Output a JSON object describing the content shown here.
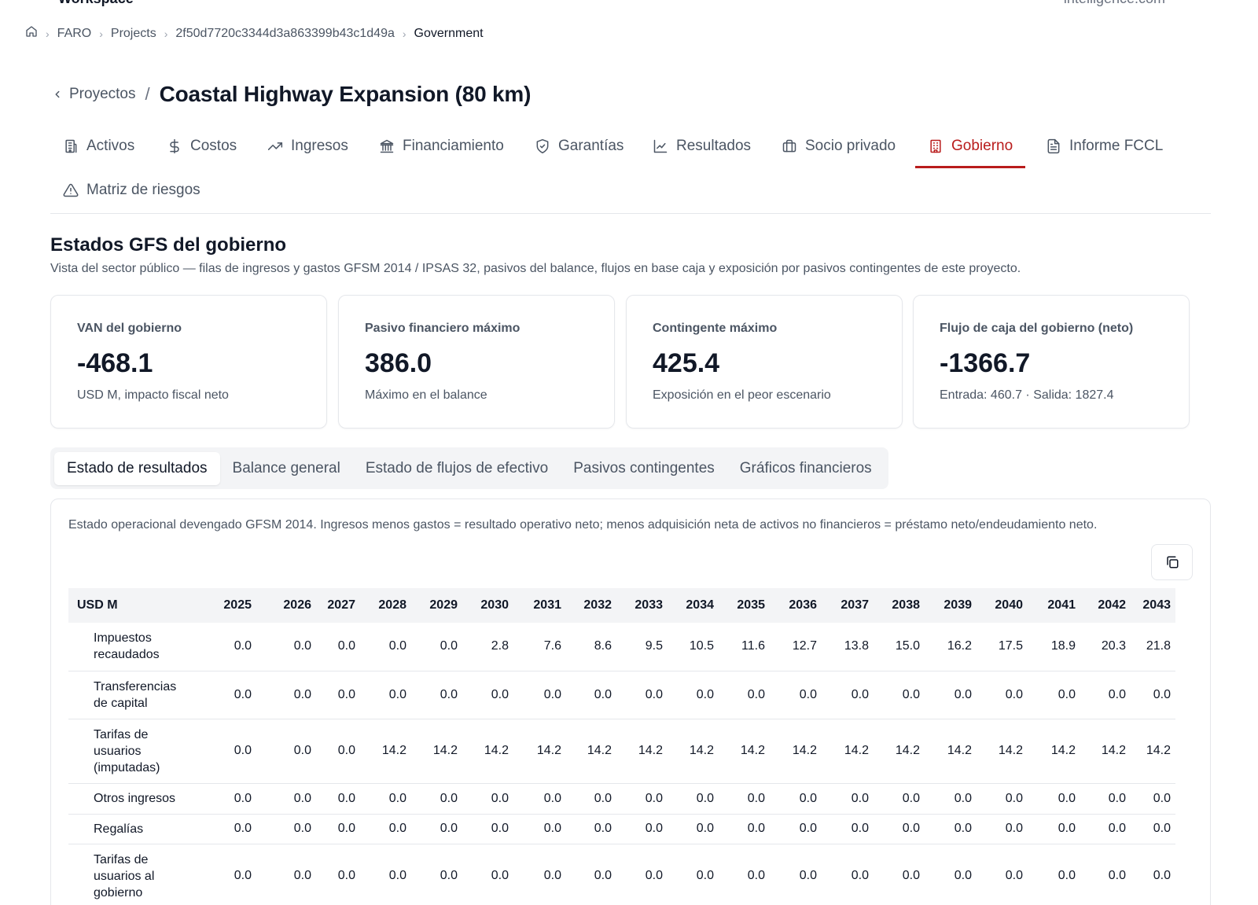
{
  "top": {
    "left_text": "Workspace",
    "right_text": "intelligence.com"
  },
  "breadcrumb": {
    "items": [
      "FARO",
      "Projects",
      "2f50d7720c3344d3a863399b43c1d49a"
    ],
    "current": "Government"
  },
  "header": {
    "back_label": "Proyectos",
    "separator": "/",
    "title": "Coastal Highway Expansion (80 km)"
  },
  "tabs": [
    {
      "label": "Activos",
      "icon": "building-icon"
    },
    {
      "label": "Costos",
      "icon": "dollar-icon"
    },
    {
      "label": "Ingresos",
      "icon": "trending-up-icon"
    },
    {
      "label": "Financiamiento",
      "icon": "bank-icon"
    },
    {
      "label": "Garantías",
      "icon": "shield-icon"
    },
    {
      "label": "Resultados",
      "icon": "line-chart-icon"
    },
    {
      "label": "Socio privado",
      "icon": "briefcase-icon"
    },
    {
      "label": "Gobierno",
      "icon": "government-building-icon",
      "active": true
    },
    {
      "label": "Informe FCCL",
      "icon": "file-icon"
    },
    {
      "label": "Matriz de riesgos",
      "icon": "warning-icon"
    }
  ],
  "section": {
    "title": "Estados GFS del gobierno",
    "description": "Vista del sector público — filas de ingresos y gastos GFSM 2014 / IPSAS 32, pasivos del balance, flujos en base caja y exposición por pasivos contingentes de este proyecto."
  },
  "kpis": [
    {
      "label": "VAN del gobierno",
      "value": "-468.1",
      "sub": "USD M, impacto fiscal neto"
    },
    {
      "label": "Pasivo financiero máximo",
      "value": "386.0",
      "sub": "Máximo en el balance"
    },
    {
      "label": "Contingente máximo",
      "value": "425.4",
      "sub": "Exposición en el peor escenario"
    },
    {
      "label": "Flujo de caja del gobierno (neto)",
      "value": "-1366.7",
      "sub": "Entrada: 460.7 · Salida: 1827.4"
    }
  ],
  "subtabs": [
    "Estado de resultados",
    "Balance general",
    "Estado de flujos de efectivo",
    "Pasivos contingentes",
    "Gráficos financieros"
  ],
  "panel": {
    "description": "Estado operacional devengado GFSM 2014. Ingresos menos gastos = resultado operativo neto; menos adquisición neta de activos no financieros = préstamo neto/endeudamiento neto.",
    "copy_icon": "copy-icon"
  },
  "table": {
    "unit_header": "USD M",
    "years": [
      "2025",
      "2026",
      "2027",
      "2028",
      "2029",
      "2030",
      "2031",
      "2032",
      "2033",
      "2034",
      "2035",
      "2036",
      "2037",
      "2038",
      "2039",
      "2040",
      "2041",
      "2042",
      "2043"
    ],
    "rows": [
      {
        "label": "Impuestos recaudados",
        "values": [
          "0.0",
          "0.0",
          "0.0",
          "0.0",
          "0.0",
          "2.8",
          "7.6",
          "8.6",
          "9.5",
          "10.5",
          "11.6",
          "12.7",
          "13.8",
          "15.0",
          "16.2",
          "17.5",
          "18.9",
          "20.3",
          "21.8"
        ]
      },
      {
        "label": "Transferencias de capital",
        "values": [
          "0.0",
          "0.0",
          "0.0",
          "0.0",
          "0.0",
          "0.0",
          "0.0",
          "0.0",
          "0.0",
          "0.0",
          "0.0",
          "0.0",
          "0.0",
          "0.0",
          "0.0",
          "0.0",
          "0.0",
          "0.0",
          "0.0"
        ]
      },
      {
        "label": "Tarifas de usuarios (imputadas)",
        "values": [
          "0.0",
          "0.0",
          "0.0",
          "14.2",
          "14.2",
          "14.2",
          "14.2",
          "14.2",
          "14.2",
          "14.2",
          "14.2",
          "14.2",
          "14.2",
          "14.2",
          "14.2",
          "14.2",
          "14.2",
          "14.2",
          "14.2"
        ]
      },
      {
        "label": "Otros ingresos",
        "values": [
          "0.0",
          "0.0",
          "0.0",
          "0.0",
          "0.0",
          "0.0",
          "0.0",
          "0.0",
          "0.0",
          "0.0",
          "0.0",
          "0.0",
          "0.0",
          "0.0",
          "0.0",
          "0.0",
          "0.0",
          "0.0",
          "0.0"
        ]
      },
      {
        "label": "Regalías",
        "values": [
          "0.0",
          "0.0",
          "0.0",
          "0.0",
          "0.0",
          "0.0",
          "0.0",
          "0.0",
          "0.0",
          "0.0",
          "0.0",
          "0.0",
          "0.0",
          "0.0",
          "0.0",
          "0.0",
          "0.0",
          "0.0",
          "0.0"
        ]
      },
      {
        "label": "Tarifas de usuarios al gobierno",
        "values": [
          "0.0",
          "0.0",
          "0.0",
          "0.0",
          "0.0",
          "0.0",
          "0.0",
          "0.0",
          "0.0",
          "0.0",
          "0.0",
          "0.0",
          "0.0",
          "0.0",
          "0.0",
          "0.0",
          "0.0",
          "0.0",
          "0.0"
        ]
      }
    ]
  },
  "colors": {
    "accent": "#b91c1c",
    "text": "#111827",
    "muted": "#4b5563",
    "border": "#e5e7eb",
    "header_bg": "#f3f4f6"
  }
}
